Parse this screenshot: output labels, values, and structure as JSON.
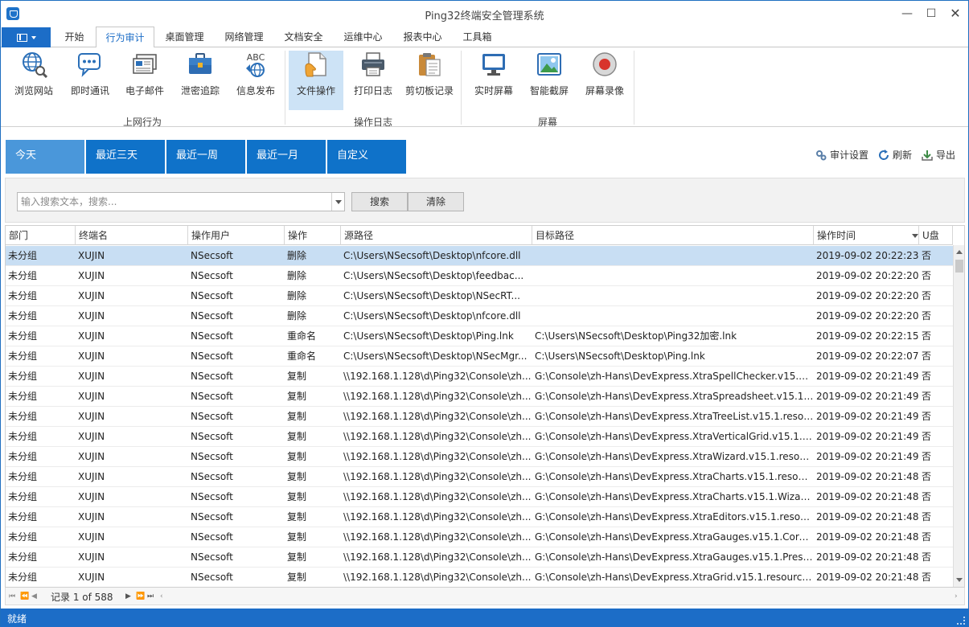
{
  "window": {
    "title": "Ping32终端安全管理系统"
  },
  "menu": {
    "tabs": [
      "开始",
      "行为审计",
      "桌面管理",
      "网络管理",
      "文档安全",
      "运维中心",
      "报表中心",
      "工具箱"
    ],
    "active": "行为审计"
  },
  "ribbon": {
    "groups": [
      {
        "label": "上网行为",
        "buttons": [
          "浏览网站",
          "即时通讯",
          "电子邮件",
          "泄密追踪",
          "信息发布"
        ]
      },
      {
        "label": "操作日志",
        "buttons": [
          "文件操作",
          "打印日志",
          "剪切板记录"
        ]
      },
      {
        "label": "屏幕",
        "buttons": [
          "实时屏幕",
          "智能截屏",
          "屏幕录像"
        ]
      }
    ],
    "selected": "文件操作",
    "icon_badge_text": "ABC"
  },
  "date_filter": {
    "tabs": [
      "今天",
      "最近三天",
      "最近一周",
      "最近一月",
      "自定义"
    ],
    "active": "今天"
  },
  "toolbar": {
    "audit_settings": "审计设置",
    "refresh": "刷新",
    "export": "导出"
  },
  "search": {
    "placeholder": "输入搜索文本，搜索...",
    "value": "",
    "search_label": "搜索",
    "clear_label": "清除"
  },
  "grid": {
    "columns": [
      "部门",
      "终端名",
      "操作用户",
      "操作",
      "源路径",
      "目标路径",
      "操作时间",
      "U盘"
    ],
    "sort_column": "操作时间",
    "sort_direction": "descending",
    "selected_row": 0,
    "rows": [
      [
        "未分组",
        "XUJIN",
        "NSecsoft",
        "删除",
        "C:\\Users\\NSecsoft\\Desktop\\nfcore.dll",
        "",
        "2019-09-02 20:22:23",
        "否"
      ],
      [
        "未分组",
        "XUJIN",
        "NSecsoft",
        "删除",
        "C:\\Users\\NSecsoft\\Desktop\\feedbac...",
        "",
        "2019-09-02 20:22:20",
        "否"
      ],
      [
        "未分组",
        "XUJIN",
        "NSecsoft",
        "删除",
        "C:\\Users\\NSecsoft\\Desktop\\NSecRT...",
        "",
        "2019-09-02 20:22:20",
        "否"
      ],
      [
        "未分组",
        "XUJIN",
        "NSecsoft",
        "删除",
        "C:\\Users\\NSecsoft\\Desktop\\nfcore.dll",
        "",
        "2019-09-02 20:22:20",
        "否"
      ],
      [
        "未分组",
        "XUJIN",
        "NSecsoft",
        "重命名",
        "C:\\Users\\NSecsoft\\Desktop\\Ping.lnk",
        "C:\\Users\\NSecsoft\\Desktop\\Ping32加密.lnk",
        "2019-09-02 20:22:15",
        "否"
      ],
      [
        "未分组",
        "XUJIN",
        "NSecsoft",
        "重命名",
        "C:\\Users\\NSecsoft\\Desktop\\NSecMgr...",
        "C:\\Users\\NSecsoft\\Desktop\\Ping.lnk",
        "2019-09-02 20:22:07",
        "否"
      ],
      [
        "未分组",
        "XUJIN",
        "NSecsoft",
        "复制",
        "\\\\192.168.1.128\\d\\Ping32\\Console\\zh...",
        "G:\\Console\\zh-Hans\\DevExpress.XtraSpellChecker.v15.1....",
        "2019-09-02 20:21:49",
        "否"
      ],
      [
        "未分组",
        "XUJIN",
        "NSecsoft",
        "复制",
        "\\\\192.168.1.128\\d\\Ping32\\Console\\zh...",
        "G:\\Console\\zh-Hans\\DevExpress.XtraSpreadsheet.v15.1.r...",
        "2019-09-02 20:21:49",
        "否"
      ],
      [
        "未分组",
        "XUJIN",
        "NSecsoft",
        "复制",
        "\\\\192.168.1.128\\d\\Ping32\\Console\\zh...",
        "G:\\Console\\zh-Hans\\DevExpress.XtraTreeList.v15.1.resou...",
        "2019-09-02 20:21:49",
        "否"
      ],
      [
        "未分组",
        "XUJIN",
        "NSecsoft",
        "复制",
        "\\\\192.168.1.128\\d\\Ping32\\Console\\zh...",
        "G:\\Console\\zh-Hans\\DevExpress.XtraVerticalGrid.v15.1.re...",
        "2019-09-02 20:21:49",
        "否"
      ],
      [
        "未分组",
        "XUJIN",
        "NSecsoft",
        "复制",
        "\\\\192.168.1.128\\d\\Ping32\\Console\\zh...",
        "G:\\Console\\zh-Hans\\DevExpress.XtraWizard.v15.1.resour...",
        "2019-09-02 20:21:49",
        "否"
      ],
      [
        "未分组",
        "XUJIN",
        "NSecsoft",
        "复制",
        "\\\\192.168.1.128\\d\\Ping32\\Console\\zh...",
        "G:\\Console\\zh-Hans\\DevExpress.XtraCharts.v15.1.resour...",
        "2019-09-02 20:21:48",
        "否"
      ],
      [
        "未分组",
        "XUJIN",
        "NSecsoft",
        "复制",
        "\\\\192.168.1.128\\d\\Ping32\\Console\\zh...",
        "G:\\Console\\zh-Hans\\DevExpress.XtraCharts.v15.1.Wizard...",
        "2019-09-02 20:21:48",
        "否"
      ],
      [
        "未分组",
        "XUJIN",
        "NSecsoft",
        "复制",
        "\\\\192.168.1.128\\d\\Ping32\\Console\\zh...",
        "G:\\Console\\zh-Hans\\DevExpress.XtraEditors.v15.1.resour...",
        "2019-09-02 20:21:48",
        "否"
      ],
      [
        "未分组",
        "XUJIN",
        "NSecsoft",
        "复制",
        "\\\\192.168.1.128\\d\\Ping32\\Console\\zh...",
        "G:\\Console\\zh-Hans\\DevExpress.XtraGauges.v15.1.Core.r...",
        "2019-09-02 20:21:48",
        "否"
      ],
      [
        "未分组",
        "XUJIN",
        "NSecsoft",
        "复制",
        "\\\\192.168.1.128\\d\\Ping32\\Console\\zh...",
        "G:\\Console\\zh-Hans\\DevExpress.XtraGauges.v15.1.Preset...",
        "2019-09-02 20:21:48",
        "否"
      ],
      [
        "未分组",
        "XUJIN",
        "NSecsoft",
        "复制",
        "\\\\192.168.1.128\\d\\Ping32\\Console\\zh...",
        "G:\\Console\\zh-Hans\\DevExpress.XtraGrid.v15.1.resource...",
        "2019-09-02 20:21:48",
        "否"
      ]
    ]
  },
  "navigator": {
    "record_text": "记录 1 of 588"
  },
  "status": {
    "text": "就绪"
  },
  "colors": {
    "accent": "#1c6dc7",
    "tab_active": "#4a97da",
    "tab": "#0f72c9",
    "row_selected": "#c8def3"
  }
}
